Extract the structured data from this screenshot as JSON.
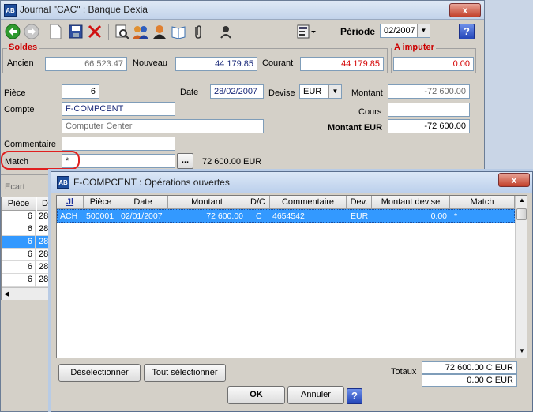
{
  "window": {
    "title": "Journal \"CAC\" : Banque Dexia",
    "close_glyph": "x",
    "app_icon_text": "AB"
  },
  "toolbar": {
    "periode_label": "Période",
    "periode_value": "02/2007"
  },
  "soldes": {
    "title": "Soldes",
    "ancien_label": "Ancien",
    "ancien_value": "66 523.47",
    "nouveau_label": "Nouveau",
    "nouveau_value": "44 179.85",
    "courant_label": "Courant",
    "courant_value": "44 179.85"
  },
  "a_imputer": {
    "title": "A imputer",
    "value": "0.00"
  },
  "form": {
    "piece_label": "Pièce",
    "piece_value": "6",
    "date_label": "Date",
    "date_value": "28/02/2007",
    "compte_label": "Compte",
    "compte_value": "F-COMPCENT",
    "compte_name": "Computer Center",
    "commentaire_label": "Commentaire",
    "commentaire_value": "",
    "match_label": "Match",
    "match_value": "*",
    "browse_label": "...",
    "match_amount": "72 600.00 EUR",
    "devise_label": "Devise",
    "devise_value": "EUR",
    "montant_label": "Montant",
    "montant_value": "-72 600.00",
    "cours_label": "Cours",
    "cours_value": "",
    "montant_eur_label": "Montant EUR",
    "montant_eur_value": "-72 600.00",
    "ecart_label": "Ecart"
  },
  "bg_table": {
    "col_piece": "Pièce",
    "col_date_partial": "D",
    "rows": [
      {
        "piece": "6",
        "date": "28"
      },
      {
        "piece": "6",
        "date": "28"
      },
      {
        "piece": "6",
        "date": "28"
      },
      {
        "piece": "6",
        "date": "28"
      },
      {
        "piece": "6",
        "date": "28"
      },
      {
        "piece": "6",
        "date": "28"
      }
    ]
  },
  "dialog": {
    "title": "F-COMPCENT : Opérations ouvertes",
    "close_glyph": "x",
    "columns": {
      "jl": "Jl",
      "piece": "Pièce",
      "date": "Date",
      "montant": "Montant",
      "dc": "D/C",
      "commentaire": "Commentaire",
      "dev": "Dev.",
      "montant_devise": "Montant devise",
      "match": "Match"
    },
    "rows": [
      {
        "jl": "ACH",
        "piece": "500001",
        "date": "02/01/2007",
        "montant": "72 600.00",
        "dc": "C",
        "commentaire": "4654542",
        "dev": "EUR",
        "montant_devise": "0.00",
        "match": "*"
      }
    ],
    "deselect_label": "Désélectionner",
    "select_all_label": "Tout sélectionner",
    "totaux_label": "Totaux",
    "total_1": "72 600.00 C EUR",
    "total_2": "0.00 C EUR",
    "ok_label": "OK",
    "annuler_label": "Annuler",
    "help_label": "?"
  },
  "colors": {
    "accent_red": "#d40000",
    "selection_blue": "#3399ff",
    "highlight_circle": "#e02020"
  }
}
